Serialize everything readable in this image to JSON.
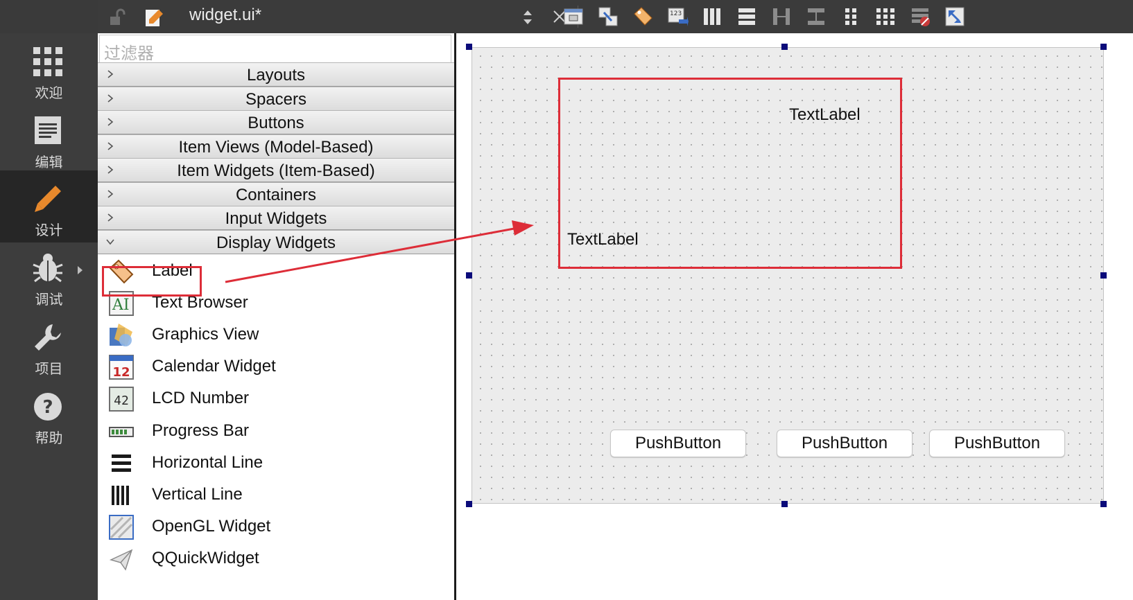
{
  "modes": [
    {
      "label": "欢迎",
      "icon": "grid-icon"
    },
    {
      "label": "编辑",
      "icon": "document-icon"
    },
    {
      "label": "设计",
      "icon": "pencil-icon"
    },
    {
      "label": "调试",
      "icon": "bug-icon"
    },
    {
      "label": "项目",
      "icon": "wrench-icon"
    },
    {
      "label": "帮助",
      "icon": "help-icon"
    }
  ],
  "toolbar": {
    "document_title": "widget.ui*"
  },
  "widget_box": {
    "filter_placeholder": "过滤器",
    "categories": [
      {
        "label": "Layouts",
        "expanded": false
      },
      {
        "label": "Spacers",
        "expanded": false
      },
      {
        "label": "Buttons",
        "expanded": false
      },
      {
        "label": "Item Views (Model-Based)",
        "expanded": false
      },
      {
        "label": "Item Widgets (Item-Based)",
        "expanded": false
      },
      {
        "label": "Containers",
        "expanded": false
      },
      {
        "label": "Input Widgets",
        "expanded": false
      },
      {
        "label": "Display Widgets",
        "expanded": true
      }
    ],
    "display_widgets": [
      {
        "label": "Label",
        "icon": "label-tag-icon"
      },
      {
        "label": "Text Browser",
        "icon": "text-browser-icon"
      },
      {
        "label": "Graphics View",
        "icon": "graphics-view-icon"
      },
      {
        "label": "Calendar Widget",
        "icon": "calendar-icon"
      },
      {
        "label": "LCD Number",
        "icon": "lcd-number-icon"
      },
      {
        "label": "Progress Bar",
        "icon": "progress-bar-icon"
      },
      {
        "label": "Horizontal Line",
        "icon": "horizontal-line-icon"
      },
      {
        "label": "Vertical Line",
        "icon": "vertical-line-icon"
      },
      {
        "label": "OpenGL Widget",
        "icon": "opengl-icon"
      },
      {
        "label": "QQuickWidget",
        "icon": "quick-widget-icon"
      }
    ],
    "calendar_day": "12",
    "lcd_digits": "42"
  },
  "form": {
    "label_top": "TextLabel",
    "label_bottom": "TextLabel",
    "buttons": [
      "PushButton",
      "PushButton",
      "PushButton"
    ]
  },
  "colors": {
    "highlight_red": "#dd2d38",
    "selection_handle": "#0b0b7a",
    "design_accent": "#e8892c"
  }
}
